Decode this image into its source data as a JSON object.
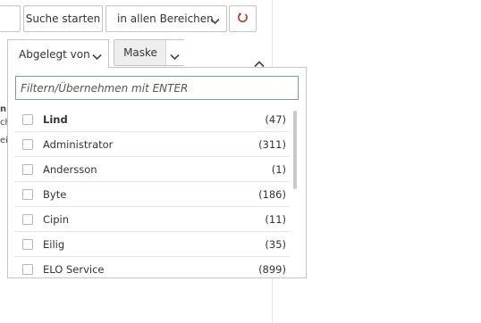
{
  "toolbar": {
    "search_button_label": "Suche starten",
    "area_select_value": "in allen Bereichen"
  },
  "filters": {
    "owner_tab_label": "Abgelegt von",
    "mask_tab_label": "Maske"
  },
  "background_text": [
    "n",
    "ch",
    "eil"
  ],
  "dropdown": {
    "filter_placeholder": "Filtern/Übernehmen mit ENTER",
    "items": [
      {
        "label": "Lind",
        "count": "(47)"
      },
      {
        "label": "Administrator",
        "count": "(311)"
      },
      {
        "label": "Andersson",
        "count": "(1)"
      },
      {
        "label": "Byte",
        "count": "(186)"
      },
      {
        "label": "Cipin",
        "count": "(11)"
      },
      {
        "label": "Eilig",
        "count": "(35)"
      },
      {
        "label": "ELO Service",
        "count": "(899)"
      }
    ]
  },
  "colors": {
    "reset_icon": "#c0392b",
    "border": "#c4c4c4",
    "input_focus_border": "#7a9bb2"
  },
  "icons": {
    "area_select": "chevron-down-icon",
    "reset": "reset-icon",
    "collapse": "chevron-up-icon"
  }
}
